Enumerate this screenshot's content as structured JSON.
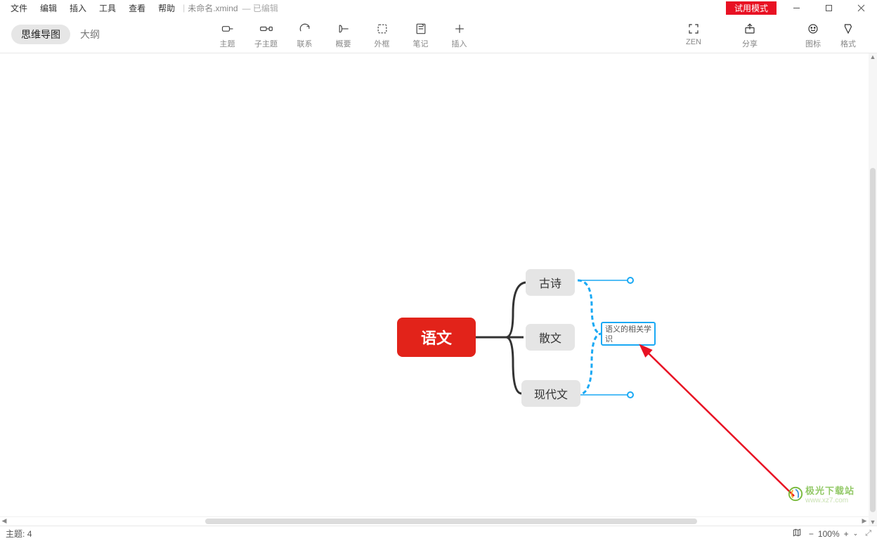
{
  "menu": {
    "file": "文件",
    "edit": "编辑",
    "insert": "插入",
    "tools": "工具",
    "view": "查看",
    "help": "帮助"
  },
  "title": {
    "filename": "未命名.xmind",
    "status": "— 已编辑"
  },
  "trial_badge": "试用模式",
  "view_toggle": {
    "mindmap": "思维导图",
    "outline": "大纲"
  },
  "tools": {
    "topic": "主题",
    "subtopic": "子主题",
    "relationship": "联系",
    "summary": "概要",
    "boundary": "外框",
    "notes": "笔记",
    "insert": "插入"
  },
  "right_tools": {
    "zen": "ZEN",
    "share": "分享",
    "markers": "图标",
    "style": "格式"
  },
  "nodes": {
    "central": "语文",
    "c1": "古诗",
    "c2": "散文",
    "c3": "现代文",
    "summary": "语义的相关学识"
  },
  "status": {
    "topic_count_label": "主题:",
    "topic_count": "4",
    "zoom": "100%"
  },
  "watermark": {
    "name": "极光下载站",
    "sub": "www.xz7.com"
  }
}
